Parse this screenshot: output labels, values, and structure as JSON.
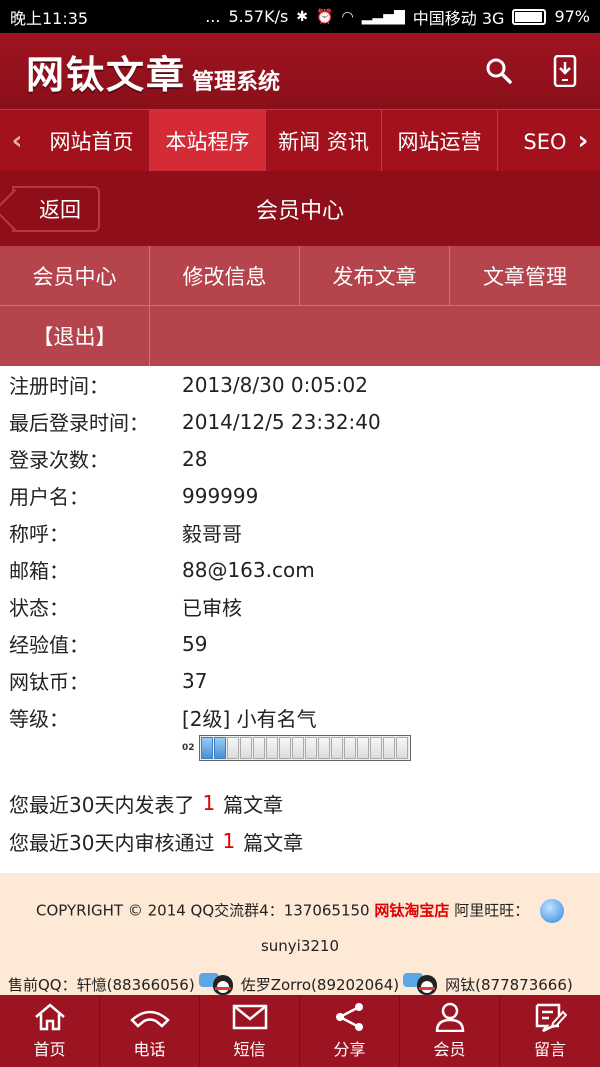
{
  "status_bar": {
    "time": "晚上11:35",
    "dots": "...",
    "speed": "5.57K/s",
    "carrier": "中国移动 3G",
    "battery": "97%"
  },
  "header": {
    "logo": "网钛文章",
    "subtitle": "管理系统",
    "icons": [
      "search-icon",
      "phone-icon"
    ]
  },
  "nav": {
    "items": [
      {
        "label": "网站首页"
      },
      {
        "label": "本站程序",
        "active": true
      },
      {
        "label": "新闻 资讯"
      },
      {
        "label": "网站运营"
      },
      {
        "label": "SEO优"
      }
    ]
  },
  "titlebar": {
    "back": "返回",
    "title": "会员中心"
  },
  "menu": {
    "items": [
      "会员中心",
      "修改信息",
      "发布文章",
      "文章管理",
      "【退出】"
    ]
  },
  "info": {
    "rows": [
      {
        "label": "注册时间：",
        "value": "2013/8/30 0:05:02"
      },
      {
        "label": "最后登录时间：",
        "value": "2014/12/5 23:32:40"
      },
      {
        "label": "登录次数：",
        "value": "28"
      },
      {
        "label": "用户名：",
        "value": "999999"
      },
      {
        "label": "称呼：",
        "value": "毅哥哥"
      },
      {
        "label": "邮箱：",
        "value": "88@163.com"
      },
      {
        "label": "状态：",
        "value": "已审核"
      },
      {
        "label": "经验值：",
        "value": "59"
      },
      {
        "label": "网钛币：",
        "value": "37"
      },
      {
        "label": "等级：",
        "value": "[2级] 小有名气"
      }
    ],
    "level": {
      "tag": "02",
      "filled": 2,
      "total": 16
    }
  },
  "stats": {
    "published": {
      "pre": "您最近30天内发表了",
      "num": "1",
      "post": "篇文章"
    },
    "approved": {
      "pre": "您最近30天内审核通过",
      "num": "1",
      "post": "篇文章"
    }
  },
  "footer": {
    "copyright": "COPYRIGHT © 2014 QQ交流群4：137065150",
    "shop": "网钛淘宝店",
    "wangwang_label": "阿里旺旺：",
    "wangwang_id": "sunyi3210",
    "presale_label": "售前QQ：",
    "qq1": "轩憶(88366056)",
    "qq2": "佐罗Zorro(89202064)",
    "qq3": "网钛(877873666)"
  },
  "tabbar": {
    "items": [
      {
        "label": "首页",
        "icon": "home-icon"
      },
      {
        "label": "电话",
        "icon": "phone-call-icon"
      },
      {
        "label": "短信",
        "icon": "mail-icon"
      },
      {
        "label": "分享",
        "icon": "share-icon"
      },
      {
        "label": "会员",
        "icon": "user-icon"
      },
      {
        "label": "留言",
        "icon": "edit-icon"
      }
    ]
  },
  "colors": {
    "primary": "#9c1421",
    "menu": "#b5444d",
    "active_nav": "#d42b37",
    "highlight": "#e00000",
    "footer_bg": "#fde9d6"
  }
}
